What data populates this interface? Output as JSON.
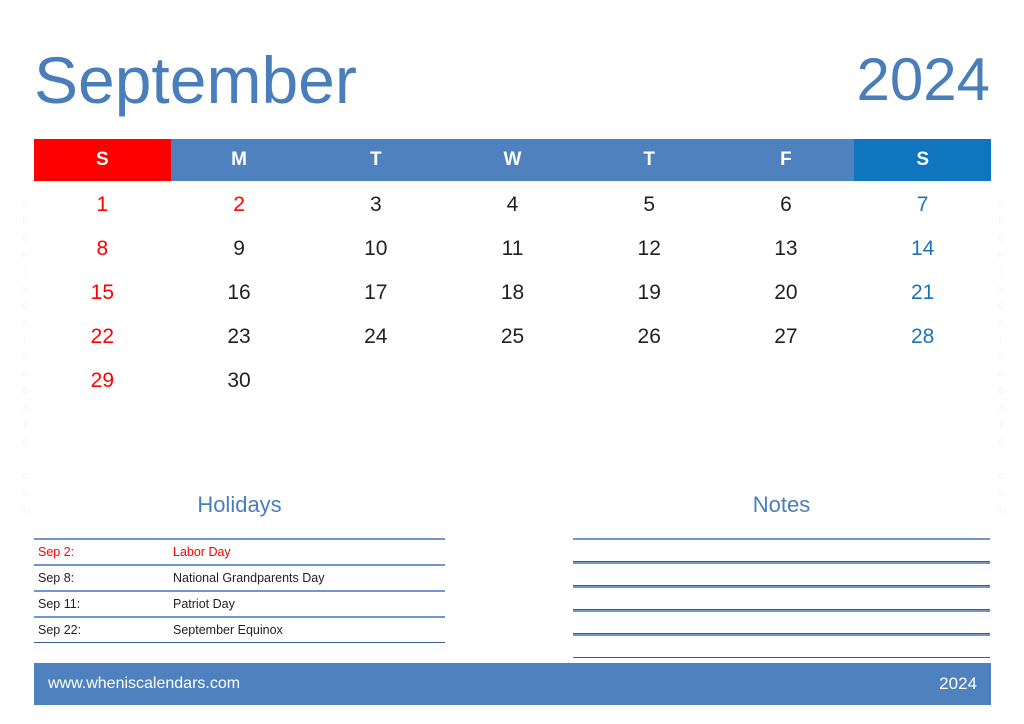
{
  "header": {
    "month": "September",
    "year": "2024"
  },
  "weekdays": [
    {
      "label": "S",
      "kind": "sun"
    },
    {
      "label": "M",
      "kind": "wd"
    },
    {
      "label": "T",
      "kind": "wd"
    },
    {
      "label": "W",
      "kind": "wd"
    },
    {
      "label": "T",
      "kind": "wd"
    },
    {
      "label": "F",
      "kind": "wd"
    },
    {
      "label": "S",
      "kind": "sat"
    }
  ],
  "weeks": [
    [
      {
        "day": "1",
        "kind": "sun"
      },
      {
        "day": "2",
        "kind": "holiday"
      },
      {
        "day": "3",
        "kind": "wd"
      },
      {
        "day": "4",
        "kind": "wd"
      },
      {
        "day": "5",
        "kind": "wd"
      },
      {
        "day": "6",
        "kind": "wd"
      },
      {
        "day": "7",
        "kind": "sat"
      }
    ],
    [
      {
        "day": "8",
        "kind": "sun"
      },
      {
        "day": "9",
        "kind": "wd"
      },
      {
        "day": "10",
        "kind": "wd"
      },
      {
        "day": "11",
        "kind": "wd"
      },
      {
        "day": "12",
        "kind": "wd"
      },
      {
        "day": "13",
        "kind": "wd"
      },
      {
        "day": "14",
        "kind": "sat"
      }
    ],
    [
      {
        "day": "15",
        "kind": "sun"
      },
      {
        "day": "16",
        "kind": "wd"
      },
      {
        "day": "17",
        "kind": "wd"
      },
      {
        "day": "18",
        "kind": "wd"
      },
      {
        "day": "19",
        "kind": "wd"
      },
      {
        "day": "20",
        "kind": "wd"
      },
      {
        "day": "21",
        "kind": "sat"
      }
    ],
    [
      {
        "day": "22",
        "kind": "sun"
      },
      {
        "day": "23",
        "kind": "wd"
      },
      {
        "day": "24",
        "kind": "wd"
      },
      {
        "day": "25",
        "kind": "wd"
      },
      {
        "day": "26",
        "kind": "wd"
      },
      {
        "day": "27",
        "kind": "wd"
      },
      {
        "day": "28",
        "kind": "sat"
      }
    ],
    [
      {
        "day": "29",
        "kind": "sun"
      },
      {
        "day": "30",
        "kind": "wd"
      },
      {
        "day": "",
        "kind": "empty"
      },
      {
        "day": "",
        "kind": "empty"
      },
      {
        "day": "",
        "kind": "empty"
      },
      {
        "day": "",
        "kind": "empty"
      },
      {
        "day": "",
        "kind": "empty"
      }
    ]
  ],
  "holidays": {
    "heading": "Holidays",
    "items": [
      {
        "date": "Sep 2:",
        "name": "Labor Day",
        "highlight": true
      },
      {
        "date": "Sep 8:",
        "name": "National Grandparents Day",
        "highlight": false
      },
      {
        "date": "Sep 11:",
        "name": "Patriot Day",
        "highlight": false
      },
      {
        "date": "Sep 22:",
        "name": "September Equinox",
        "highlight": false
      }
    ]
  },
  "notes": {
    "heading": "Notes",
    "line_count": 5,
    "lines": [
      "",
      "",
      "",
      "",
      ""
    ]
  },
  "footer": {
    "url": "www.wheniscalendars.com",
    "year": "2024"
  },
  "watermark": {
    "text": "wheniscalendars.com"
  },
  "colors": {
    "title_blue": "#4a7ebb",
    "header_weekday_blue": "#4e81bd",
    "header_saturday_blue": "#0e75be",
    "header_sunday_red": "#ff0000",
    "saturday_date_blue": "#1a74bd",
    "sunday_date_red": "#ff0000",
    "rule_blue": "#6f96cd",
    "footer_blue": "#4e81bd"
  }
}
